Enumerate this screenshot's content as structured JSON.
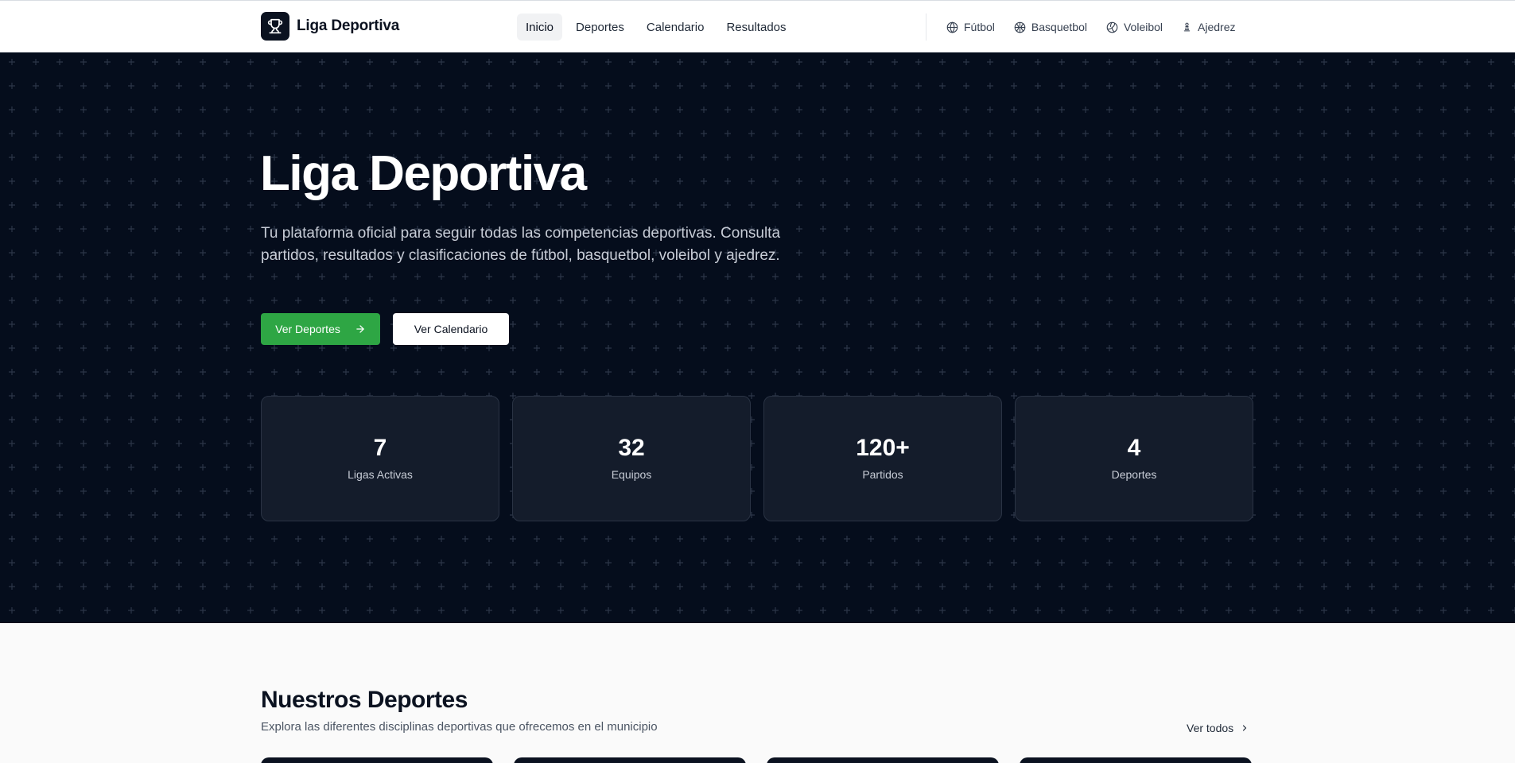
{
  "header": {
    "brand": {
      "name": "Liga Deportiva",
      "icon": "trophy-icon"
    },
    "nav": [
      {
        "label": "Inicio",
        "active": true
      },
      {
        "label": "Deportes",
        "active": false
      },
      {
        "label": "Calendario",
        "active": false
      },
      {
        "label": "Resultados",
        "active": false
      }
    ],
    "sports": [
      {
        "label": "Fútbol",
        "icon": "globe-icon"
      },
      {
        "label": "Basquetbol",
        "icon": "basketball-icon"
      },
      {
        "label": "Voleibol",
        "icon": "volleyball-icon"
      },
      {
        "label": "Ajedrez",
        "icon": "chess-pawn-icon"
      }
    ]
  },
  "hero": {
    "title": "Liga Deportiva",
    "subtitle": "Tu plataforma oficial para seguir todas las competencias deportivas. Consulta partidos, resultados y clasificaciones de fútbol, basquetbol, voleibol y ajedrez.",
    "primary_button": "Ver Deportes",
    "secondary_button": "Ver Calendario",
    "stats": [
      {
        "value": "7",
        "label": "Ligas Activas"
      },
      {
        "value": "32",
        "label": "Equipos"
      },
      {
        "value": "120+",
        "label": "Partidos"
      },
      {
        "value": "4",
        "label": "Deportes"
      }
    ]
  },
  "sports_section": {
    "title": "Nuestros Deportes",
    "subtitle": "Explora las diferentes disciplinas deportivas que ofrecemos en el municipio",
    "see_all": "Ver todos"
  },
  "colors": {
    "hero_bg": "#050d1c",
    "accent_green": "#2ea644",
    "card_bg": "#141c2b",
    "text_dark": "#0b1220"
  }
}
